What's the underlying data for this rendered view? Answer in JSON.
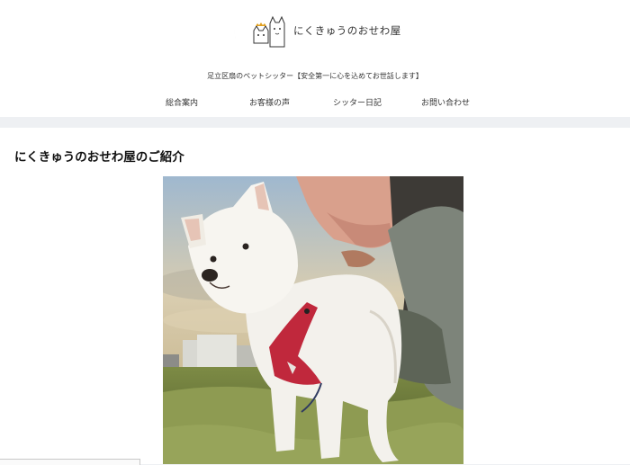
{
  "site": {
    "logo_text": "にくきゅうのおせわ屋",
    "tagline": "足立区扇のペットシッター【安全第一に心を込めてお世話します】"
  },
  "nav": {
    "items": [
      {
        "label": "総合案内"
      },
      {
        "label": "お客様の声"
      },
      {
        "label": "シッター日記"
      },
      {
        "label": "お問い合わせ"
      }
    ]
  },
  "main": {
    "section_title": "にくきゅうのおせわ屋のご紹介"
  },
  "photo": {
    "icon": "white-dog-photo"
  },
  "colors": {
    "page_bg": "#eef0f3",
    "header_bg": "#ffffff",
    "harness": "#c0283c"
  }
}
